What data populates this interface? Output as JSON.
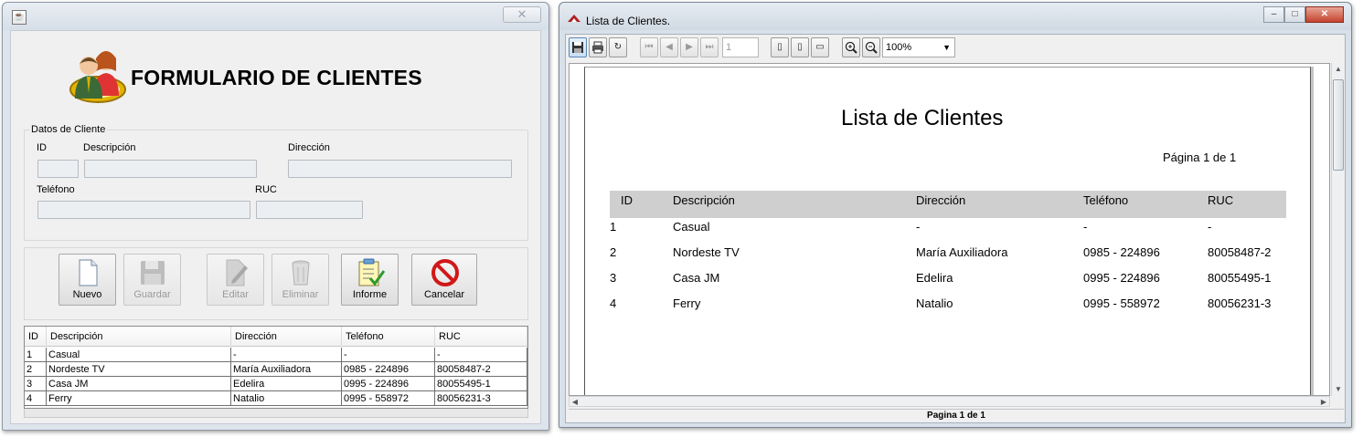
{
  "form_window": {
    "header": {
      "title": "FORMULARIO DE CLIENTES"
    },
    "group": {
      "legend": "Datos de Cliente",
      "labels": {
        "id": "ID",
        "descripcion": "Descripción",
        "direccion": "Dirección",
        "telefono": "Teléfono",
        "ruc": "RUC"
      },
      "values": {
        "id": "",
        "descripcion": "",
        "direccion": "",
        "telefono": "",
        "ruc": ""
      }
    },
    "buttons": {
      "nuevo": "Nuevo",
      "guardar": "Guardar",
      "editar": "Editar",
      "eliminar": "Eliminar",
      "informe": "Informe",
      "cancelar": "Cancelar"
    },
    "table": {
      "columns": [
        "ID",
        "Descripción",
        "Dirección",
        "Teléfono",
        "RUC"
      ],
      "rows": [
        [
          "1",
          "Casual",
          "-",
          "-",
          "-"
        ],
        [
          "2",
          "Nordeste TV",
          "María Auxiliadora",
          "0985 - 224896",
          "80058487-2"
        ],
        [
          "3",
          "Casa JM",
          "Edelira",
          "0995 - 224896",
          "80055495-1"
        ],
        [
          "4",
          "Ferry",
          "Natalio",
          "0995 - 558972",
          "80056231-3"
        ]
      ]
    }
  },
  "report_window": {
    "title": "Lista de Clientes.",
    "toolbar": {
      "page_value": "1",
      "zoom": "100%"
    },
    "report": {
      "heading": "Lista de Clientes",
      "pager": "Página 1 de 1",
      "columns": [
        "ID",
        "Descripción",
        "Dirección",
        "Teléfono",
        "RUC"
      ],
      "rows": [
        [
          "1",
          "Casual",
          "-",
          "-",
          "-"
        ],
        [
          "2",
          "Nordeste TV",
          "María Auxiliadora",
          "0985 - 224896",
          "80058487-2"
        ],
        [
          "3",
          "Casa JM",
          "Edelira",
          "0995 - 224896",
          "80055495-1"
        ],
        [
          "4",
          "Ferry",
          "Natalio",
          "0995 - 558972",
          "80056231-3"
        ]
      ]
    },
    "status": "Pagina 1 de 1"
  }
}
